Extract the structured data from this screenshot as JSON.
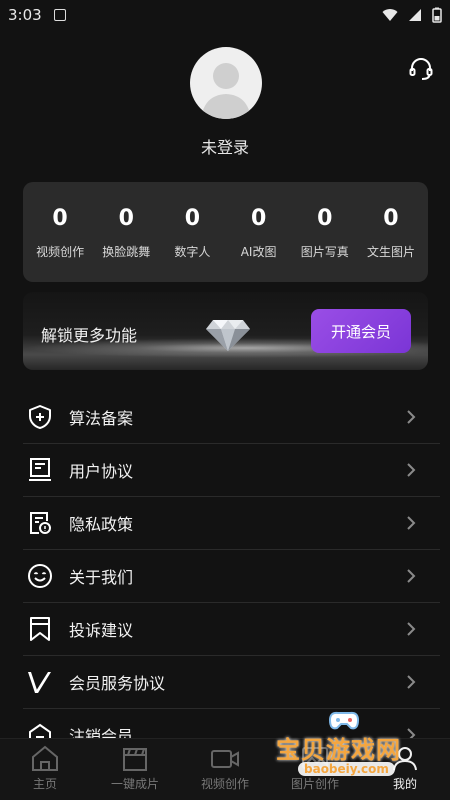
{
  "status_bar": {
    "time": "3:03"
  },
  "profile": {
    "login_text": "未登录"
  },
  "stats": [
    {
      "value": "0",
      "label": "视频创作"
    },
    {
      "value": "0",
      "label": "换脸跳舞"
    },
    {
      "value": "0",
      "label": "数字人"
    },
    {
      "value": "0",
      "label": "AI改图"
    },
    {
      "value": "0",
      "label": "图片写真"
    },
    {
      "value": "0",
      "label": "文生图片"
    }
  ],
  "vip_banner": {
    "text": "解锁更多功能",
    "button_label": "开通会员"
  },
  "menu": [
    {
      "label": "算法备案",
      "icon": "shield-plus-icon"
    },
    {
      "label": "用户协议",
      "icon": "document-icon"
    },
    {
      "label": "隐私政策",
      "icon": "privacy-policy-icon"
    },
    {
      "label": "关于我们",
      "icon": "smiley-icon"
    },
    {
      "label": "投诉建议",
      "icon": "bookmark-icon"
    },
    {
      "label": "会员服务协议",
      "icon": "v-logo-icon"
    },
    {
      "label": "注销会员",
      "icon": "deregister-icon"
    }
  ],
  "tabs": [
    {
      "label": "主页",
      "icon": "home-icon"
    },
    {
      "label": "一键成片",
      "icon": "clapperboard-icon"
    },
    {
      "label": "视频创作",
      "icon": "video-camera-icon"
    },
    {
      "label": "图片创作",
      "icon": "image-icon"
    },
    {
      "label": "我的",
      "icon": "profile-icon",
      "active": true
    }
  ],
  "watermark": {
    "text": "宝贝游戏网",
    "url": "baobeiy.com"
  },
  "colors": {
    "background": "#121212",
    "card": "#2b2b2b",
    "accent": "#8a42df",
    "watermark": "#f4a640"
  }
}
